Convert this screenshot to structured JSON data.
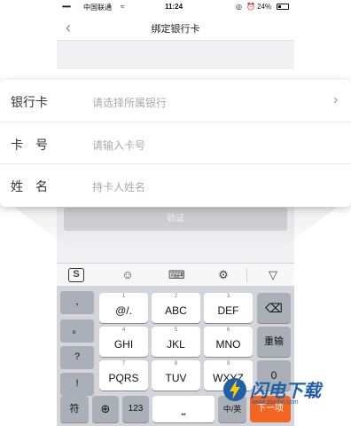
{
  "status_bar": {
    "signal": "•••••",
    "carrier": "中国联通",
    "wifi": "≈",
    "time": "11:24",
    "lock": "◎",
    "alarm": "⏰",
    "battery": "24%"
  },
  "nav": {
    "back_icon": "‹",
    "title": "绑定银行卡"
  },
  "form": {
    "rows": [
      {
        "label": "银行卡",
        "placeholder": "请选择所属银行",
        "chevron": "›"
      },
      {
        "label": "卡　号",
        "placeholder": "请输入卡号"
      },
      {
        "label": "姓　名",
        "placeholder": "持卡人姓名"
      }
    ],
    "verify_button": "验证"
  },
  "keyboard_toolbar": {
    "sogou": "S",
    "emoji": "☺",
    "keyboard": "⌨",
    "settings": "⚙",
    "hide": "▽"
  },
  "keyboard": {
    "side_keys": [
      ",",
      "。",
      "?",
      "!"
    ],
    "rows": [
      [
        {
          "num": "1",
          "main": "@/."
        },
        {
          "num": "2",
          "main": "ABC"
        },
        {
          "num": "3",
          "main": "DEF"
        }
      ],
      [
        {
          "num": "4",
          "main": "GHI"
        },
        {
          "num": "5",
          "main": "JKL"
        },
        {
          "num": "6",
          "main": "MNO"
        }
      ],
      [
        {
          "num": "7",
          "main": "PQRS"
        },
        {
          "num": "8",
          "main": "TUV"
        },
        {
          "num": "9",
          "main": "WXYZ"
        }
      ]
    ],
    "delete": "⌫",
    "reenter": "重输",
    "zero": "0",
    "bottom": {
      "symbols": "符",
      "globe": "⊕",
      "numbers": "123",
      "space": "⎵",
      "lang": "中/英",
      "next": "下一项"
    }
  },
  "watermark": {
    "text": "闪电下载",
    "url": "www.dianlut.com"
  },
  "colors": {
    "accent": "#f26522",
    "watermark": "#1f5fa8",
    "placeholder": "#aaaaaa"
  }
}
